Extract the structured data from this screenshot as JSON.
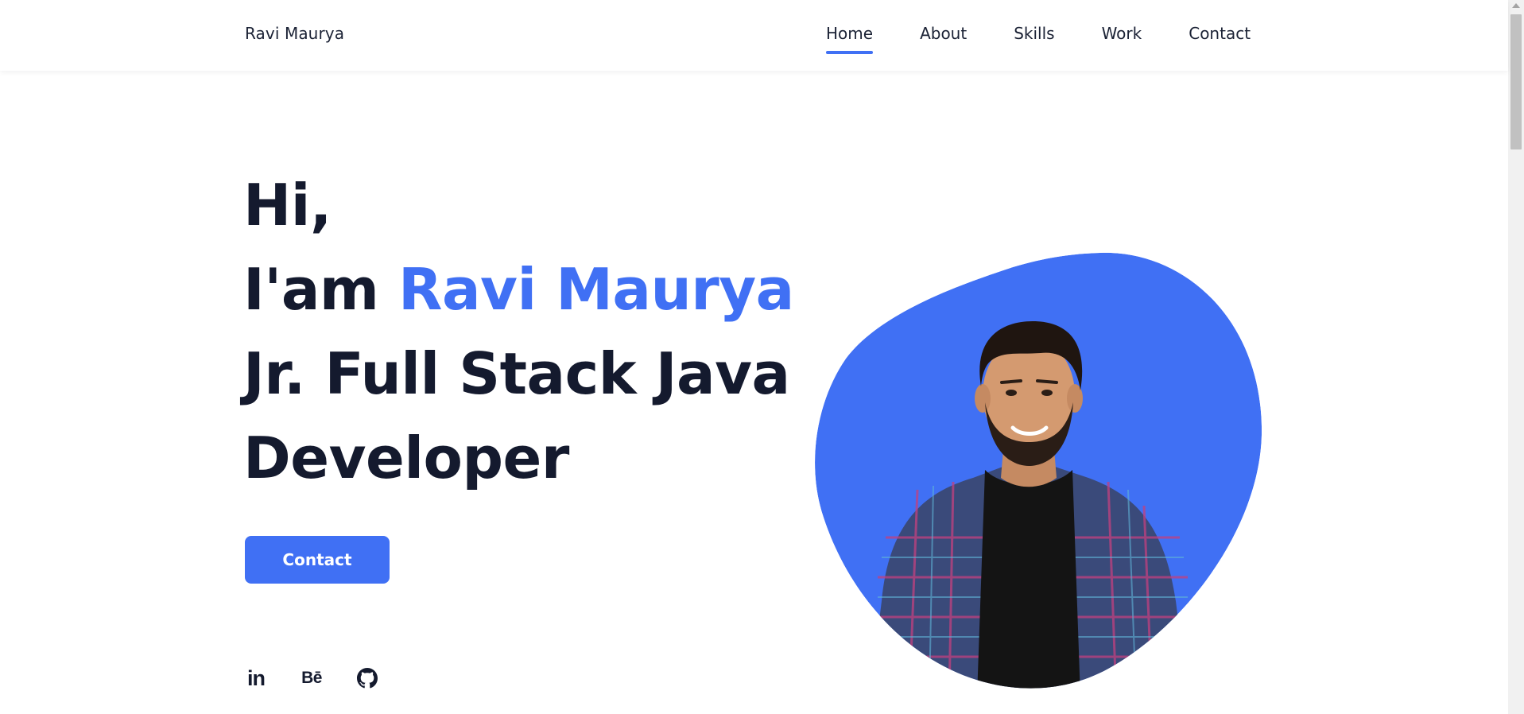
{
  "header": {
    "brand": "Ravi Maurya",
    "nav": [
      {
        "label": "Home",
        "active": true
      },
      {
        "label": "About",
        "active": false
      },
      {
        "label": "Skills",
        "active": false
      },
      {
        "label": "Work",
        "active": false
      },
      {
        "label": "Contact",
        "active": false
      }
    ]
  },
  "hero": {
    "greeting": "Hi,",
    "intro_prefix": "I'am ",
    "name": "Ravi Maurya",
    "role_line1": "Jr. Full Stack Java",
    "role_line2": "Developer",
    "contact_button": "Contact"
  },
  "social": [
    {
      "icon": "linkedin-icon",
      "glyph": "in"
    },
    {
      "icon": "behance-icon",
      "glyph": "Bē"
    },
    {
      "icon": "github-icon",
      "glyph": ""
    }
  ],
  "colors": {
    "accent": "#4070f4",
    "text": "#141a2e",
    "background": "#ffffff"
  }
}
